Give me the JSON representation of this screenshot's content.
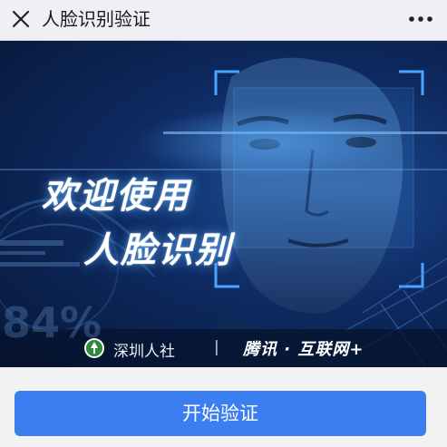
{
  "header": {
    "title": "人脸识别验证",
    "close_icon": "close-icon",
    "more_icon": "more-dots-icon"
  },
  "banner": {
    "headline_line1": "欢迎使用",
    "headline_line2": "人脸识别",
    "background_number": "84%",
    "partner_left": "深圳人社",
    "separator": "|",
    "partner_right": "腾讯 · 互联网+"
  },
  "action": {
    "start_label": "开始验证"
  },
  "colors": {
    "accent": "#3b7ef0",
    "banner_dark": "#0e2a61",
    "bracket": "#4aa3ff"
  }
}
